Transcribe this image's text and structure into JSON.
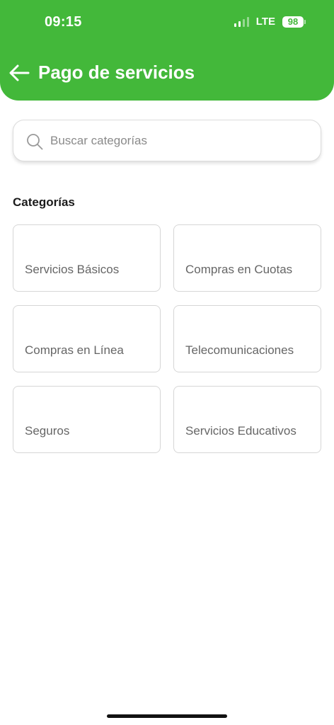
{
  "status_bar": {
    "time": "09:15",
    "network": "LTE",
    "battery": "98"
  },
  "header": {
    "title": "Pago de servicios",
    "back_icon": "arrow-left-icon"
  },
  "search": {
    "placeholder": "Buscar categorías",
    "value": ""
  },
  "section": {
    "title": "Categorías"
  },
  "categories": [
    {
      "label": "Servicios Básicos"
    },
    {
      "label": "Compras en Cuotas"
    },
    {
      "label": "Compras en Línea"
    },
    {
      "label": "Telecomunicaciones"
    },
    {
      "label": "Seguros"
    },
    {
      "label": "Servicios Educativos"
    }
  ],
  "colors": {
    "primary": "#43b83a",
    "card_border": "#d6d6d6",
    "card_text": "#666666"
  }
}
